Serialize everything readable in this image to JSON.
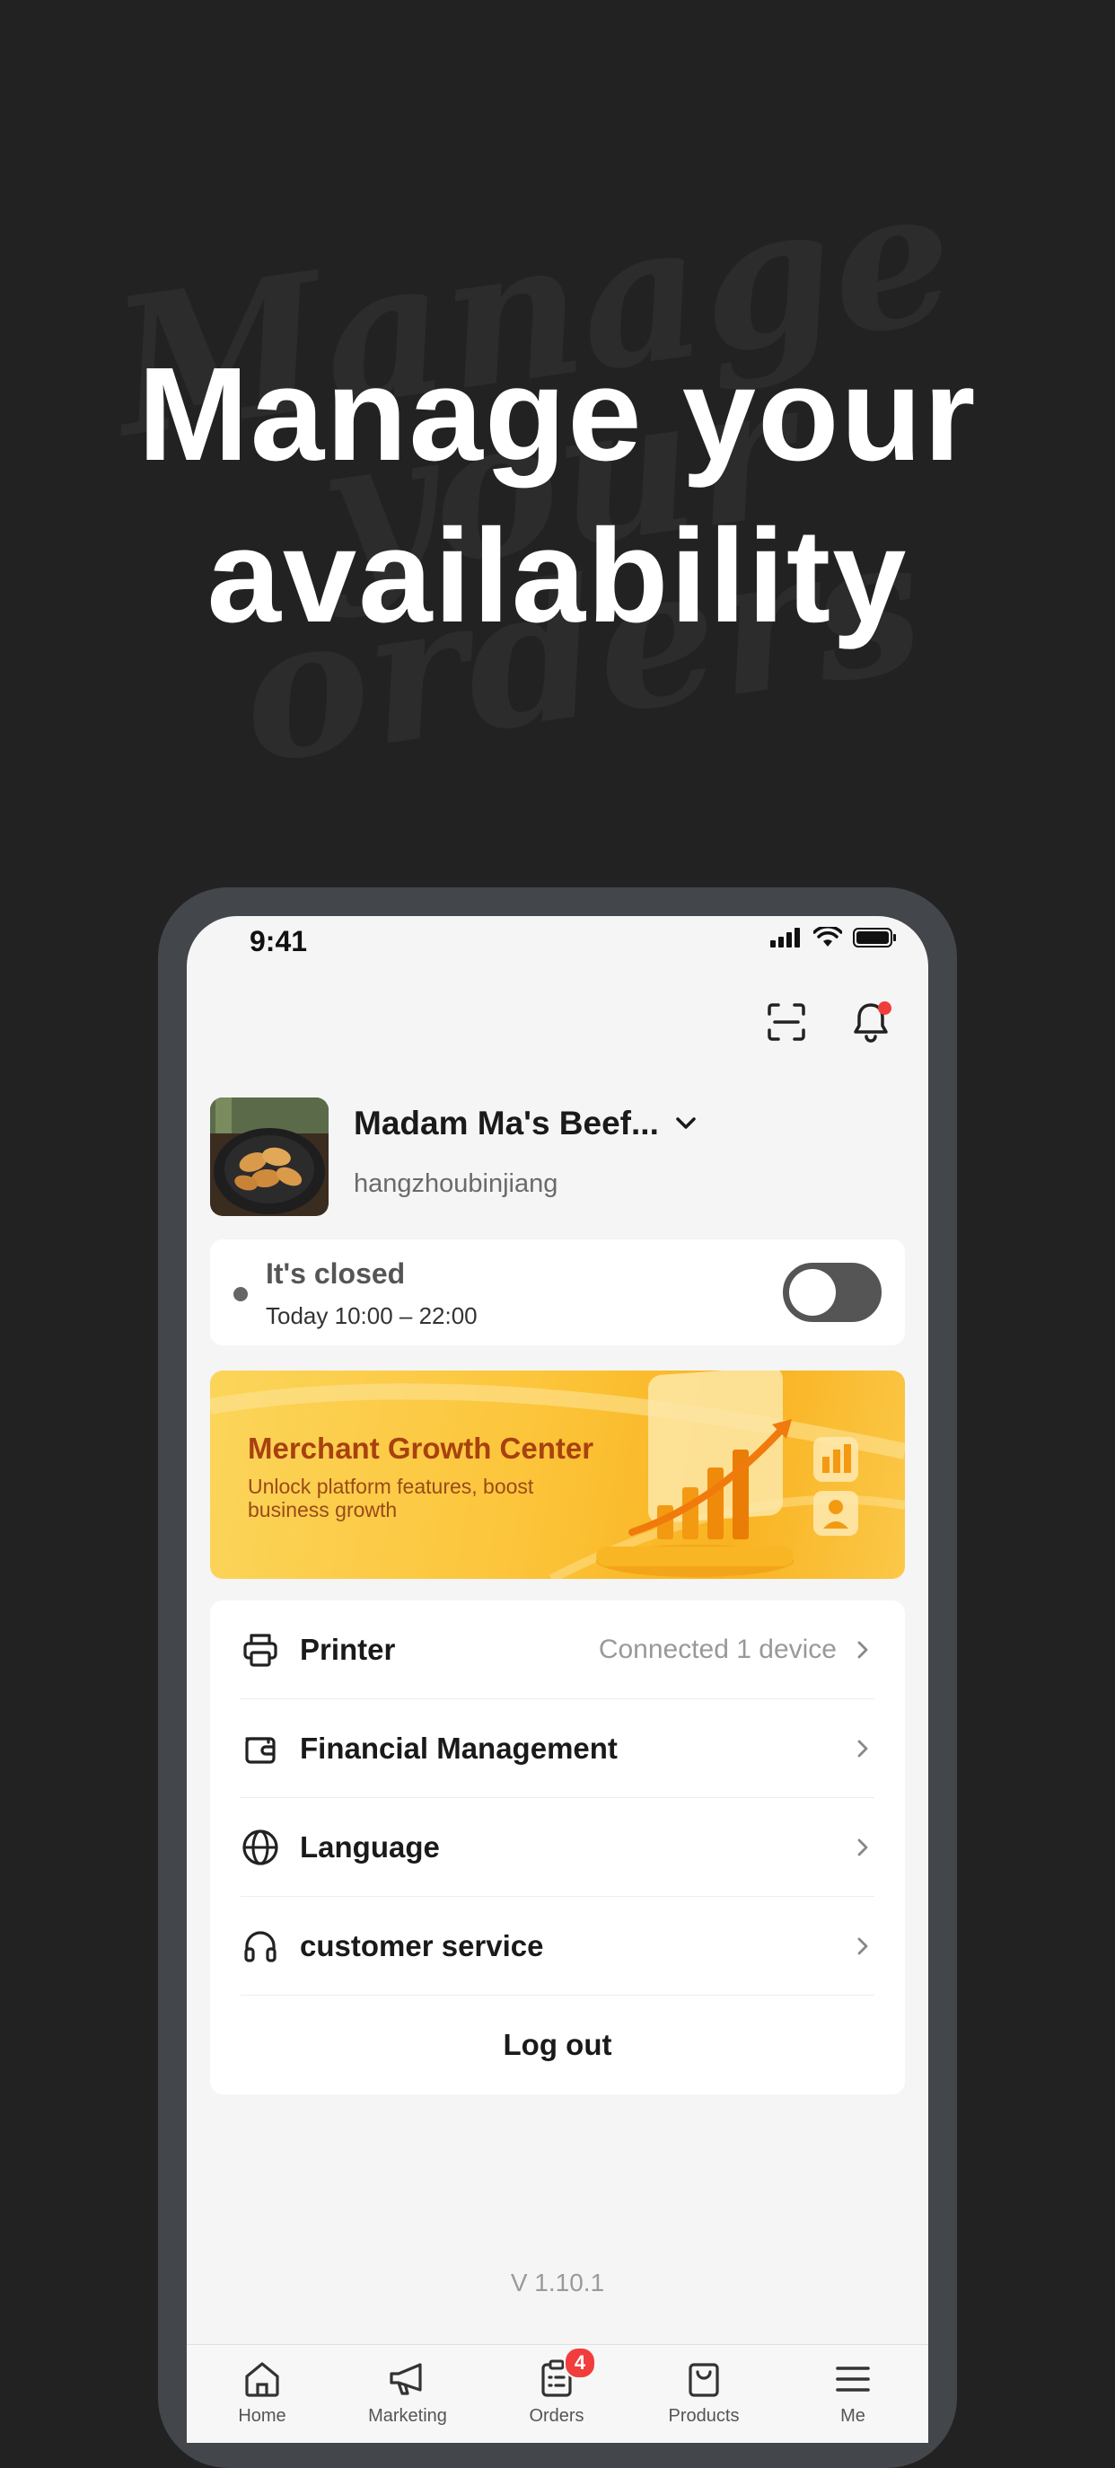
{
  "promo": {
    "headline_line1": "Manage your",
    "headline_line2": "availability",
    "watermark_line1": "Manage",
    "watermark_line2": "your orders"
  },
  "status_bar": {
    "time": "9:41"
  },
  "top_actions": {
    "scan_icon": "scan-icon",
    "bell_icon": "bell-icon",
    "has_notification": true
  },
  "store": {
    "name": "Madam Ma's Beef...",
    "subtitle": "hangzhoubinjiang",
    "image": "dumplings-photo"
  },
  "availability": {
    "title": "It's closed",
    "hours": "Today 10:00 – 22:00",
    "toggle_on": false
  },
  "banner": {
    "title": "Merchant Growth Center",
    "subtitle": "Unlock platform features, boost business growth",
    "colors": {
      "start": "#fbd55a",
      "end": "#f9b321",
      "title": "#a8410f"
    }
  },
  "menu": {
    "items": [
      {
        "label": "Printer",
        "value": "Connected 1 device",
        "icon": "printer-icon"
      },
      {
        "label": "Financial Management",
        "value": "",
        "icon": "wallet-icon"
      },
      {
        "label": "Language",
        "value": "",
        "icon": "globe-icon"
      },
      {
        "label": "customer service",
        "value": "",
        "icon": "headphones-icon"
      }
    ],
    "logout_label": "Log out"
  },
  "version": "V 1.10.1",
  "tabbar": {
    "items": [
      {
        "label": "Home",
        "icon": "home-icon"
      },
      {
        "label": "Marketing",
        "icon": "megaphone-icon"
      },
      {
        "label": "Orders",
        "icon": "orders-icon",
        "badge": "4"
      },
      {
        "label": "Products",
        "icon": "bag-icon"
      },
      {
        "label": "Me",
        "icon": "menu-icon"
      }
    ]
  },
  "colors": {
    "background": "#222223",
    "phone_frame": "#43464b",
    "badge": "#f23d3d"
  }
}
